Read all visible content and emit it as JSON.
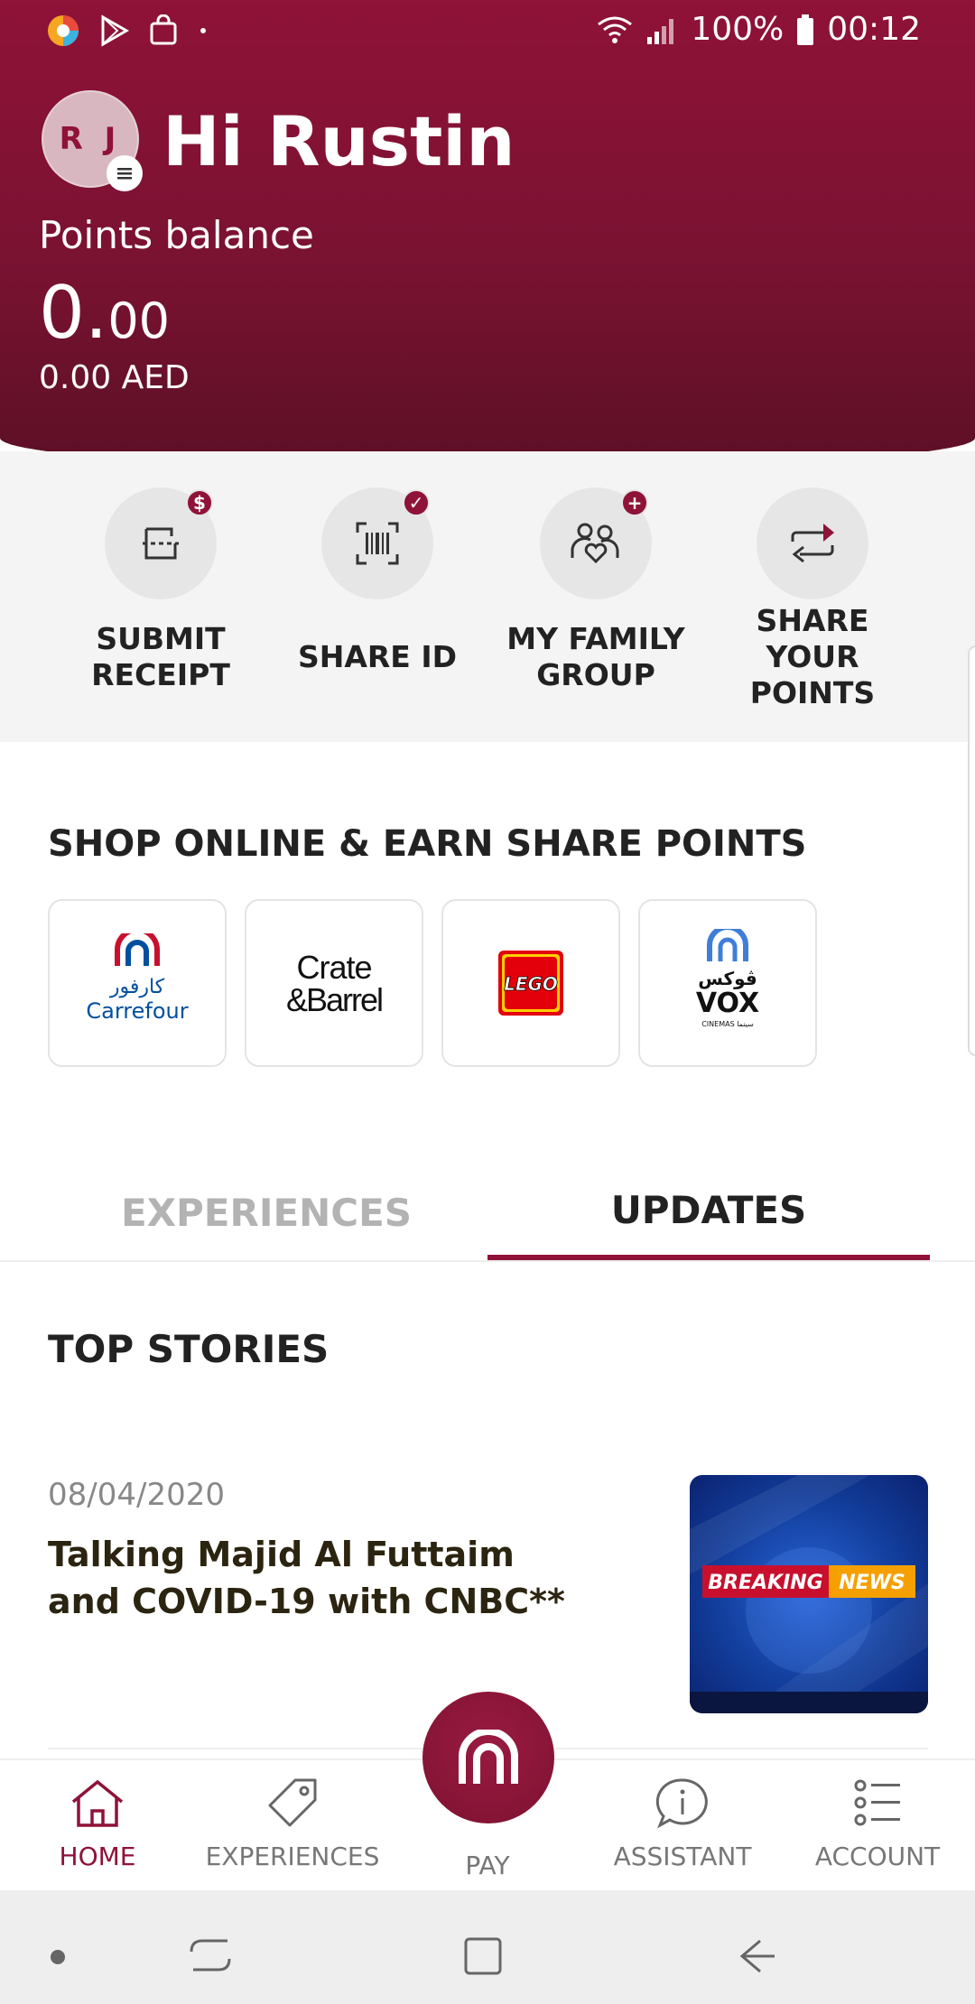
{
  "status_bar": {
    "battery": "100%",
    "time": "00:12"
  },
  "header": {
    "initials": "R J",
    "greeting": "Hi Rustin",
    "points_label": "Points balance",
    "points_whole": "0.",
    "points_decimal": "00",
    "aed_value": "0.00 AED"
  },
  "actions": [
    {
      "label": "SUBMIT RECEIPT",
      "icon": "receipt-icon",
      "badge": "$"
    },
    {
      "label": "SHARE ID",
      "icon": "barcode-icon",
      "badge": "✓"
    },
    {
      "label": "MY FAMILY GROUP",
      "icon": "family-icon",
      "badge": "+"
    },
    {
      "label": "SHARE YOUR POINTS",
      "icon": "transfer-icon",
      "badge": ""
    }
  ],
  "shop": {
    "title": "SHOP ONLINE & EARN SHARE POINTS",
    "brands": [
      {
        "name": "Carrefour",
        "arabic": "كارفور"
      },
      {
        "name_line1": "Crate",
        "name_line2": "&Barrel"
      },
      {
        "name": "LEGO"
      },
      {
        "arabic": "ڤوكس",
        "name": "VOX",
        "sub": "CINEMAS سينما"
      }
    ]
  },
  "tabs": {
    "experiences": "EXPERIENCES",
    "updates": "UPDATES"
  },
  "stories": {
    "title": "TOP STORIES",
    "items": [
      {
        "date": "08/04/2020",
        "title": "Talking Majid Al Futtaim and COVID-19 with CNBC**",
        "image_text_1": "BREAKING",
        "image_text_2": "NEWS"
      }
    ]
  },
  "bottom_nav": {
    "home": "HOME",
    "experiences": "EXPERIENCES",
    "pay": "PAY",
    "assistant": "ASSISTANT",
    "account": "ACCOUNT"
  },
  "colors": {
    "brand": "#8f1238",
    "brand_dark": "#5c1026",
    "action_bg": "#f4f4f4"
  }
}
